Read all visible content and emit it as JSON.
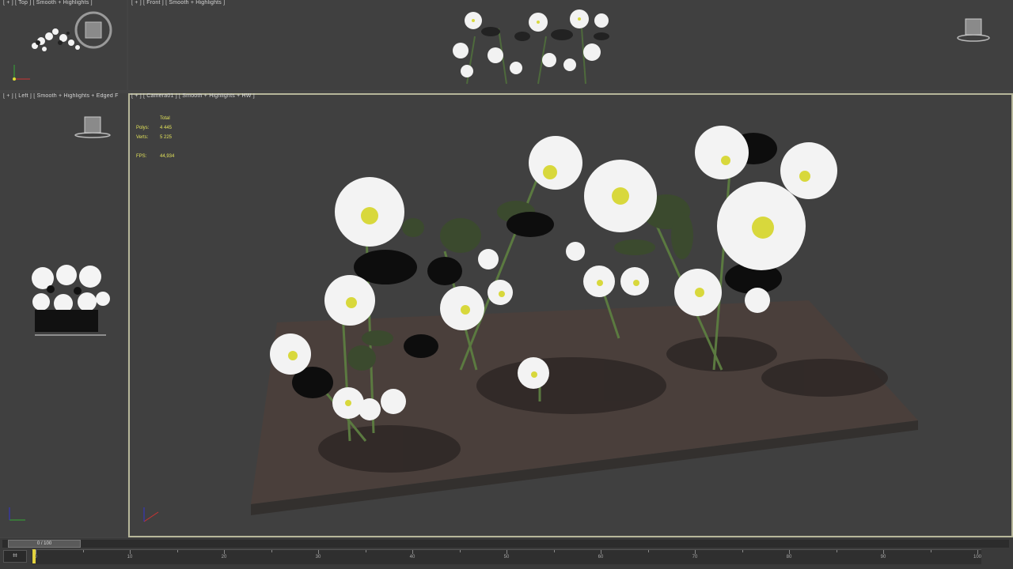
{
  "viewports": {
    "top": {
      "label": "[ + ] [ Top ] [ Smooth + Highlights ]"
    },
    "front": {
      "label": "[ + ] [ Front ] [ Smooth + Highlights ]"
    },
    "left": {
      "label": "[ + ] [ Left ] [ Smooth + Highlights + Edged F"
    },
    "camera": {
      "label": "[ + ] [ Camera01 ] [ Smooth + Highlights + HW ]",
      "stats": {
        "header": "Total",
        "polys_label": "Polys:",
        "polys_value": "4 445",
        "verts_label": "Verts:",
        "verts_value": "5 225",
        "fps_label": "FPS:",
        "fps_value": "44,934"
      }
    }
  },
  "timeline": {
    "slider_text": "0 / 100",
    "ticks": [
      "0",
      "10",
      "20",
      "30",
      "40",
      "50",
      "60",
      "70",
      "80",
      "90",
      "100"
    ],
    "current_frame": 0
  },
  "colors": {
    "viewport_bg": "#404040",
    "active_border": "#b7b79a",
    "stats_text": "#e2e25a",
    "ground": "#4a3f3b"
  }
}
